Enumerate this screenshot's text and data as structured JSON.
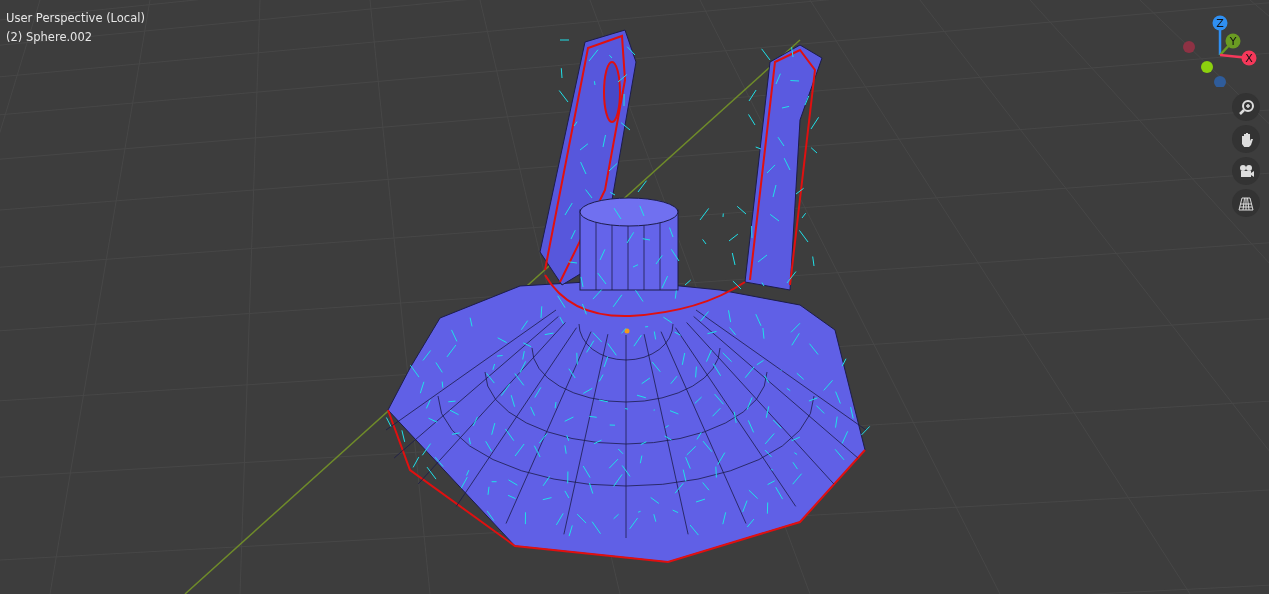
{
  "viewport": {
    "title": "User Perspective (Local)",
    "object": "(2) Sphere.002"
  },
  "gizmo": {
    "axes": [
      {
        "label": "Z",
        "color": "#2f8ff2"
      },
      {
        "label": "Y",
        "color": "#6a9b22"
      },
      {
        "label": "X",
        "color": "#f5385a"
      }
    ]
  },
  "tools": [
    {
      "kind": "zoom"
    },
    {
      "kind": "pan"
    },
    {
      "kind": "camera"
    },
    {
      "kind": "ortho"
    }
  ]
}
